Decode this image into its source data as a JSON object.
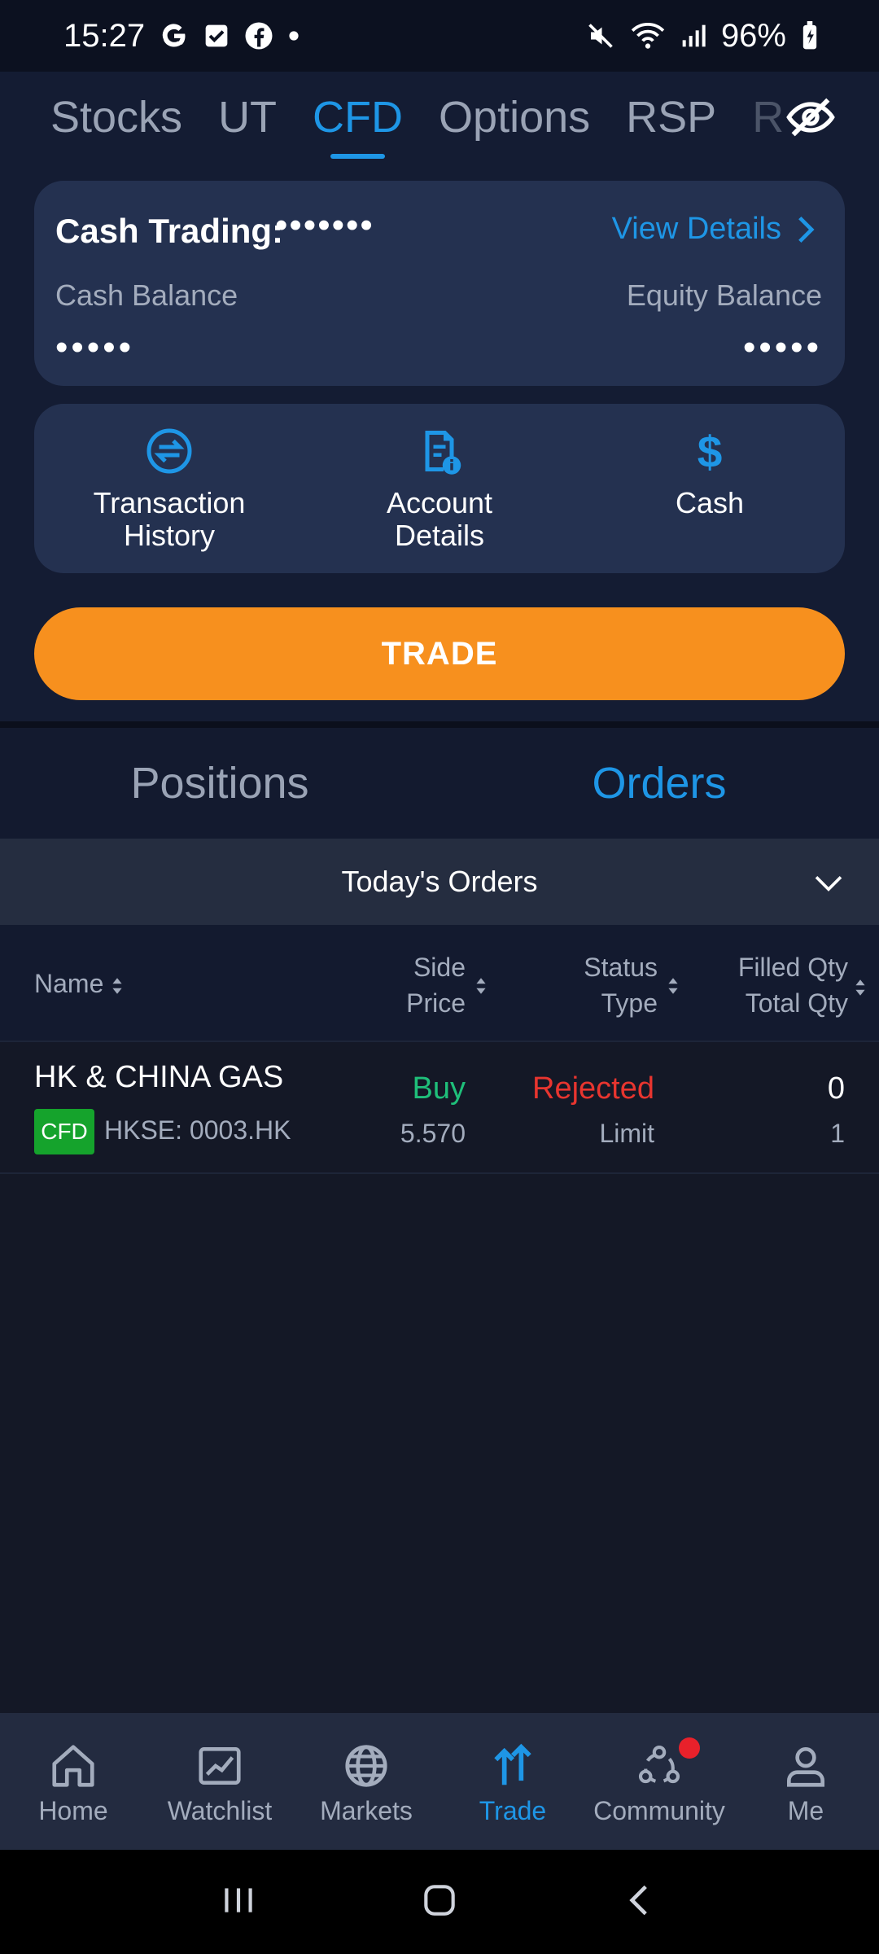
{
  "status_bar": {
    "time": "15:27",
    "battery": "96%",
    "icons": [
      "google-icon",
      "checkbox-icon",
      "facebook-icon",
      "dot-icon",
      "mute-icon",
      "wifi-icon",
      "signal-icon",
      "battery-icon"
    ]
  },
  "top_tabs": [
    {
      "label": "Stocks"
    },
    {
      "label": "UT"
    },
    {
      "label": "CFD"
    },
    {
      "label": "Options"
    },
    {
      "label": "RSP"
    },
    {
      "label": "R"
    }
  ],
  "cash_card": {
    "title": "Cash Trading:",
    "account_masked": "•••••••",
    "view_details": "View Details",
    "cash_balance_label": "Cash Balance",
    "cash_balance_value": "•••••",
    "equity_balance_label": "Equity Balance",
    "equity_balance_value": "•••••"
  },
  "actions": [
    {
      "label": "Transaction History"
    },
    {
      "label": "Account Details"
    },
    {
      "label": "Cash"
    }
  ],
  "trade_button": "TRADE",
  "list_tabs": {
    "positions": "Positions",
    "orders": "Orders"
  },
  "orders_filter": "Today's Orders",
  "table_headers": {
    "name": "Name",
    "side": "Side",
    "price": "Price",
    "status": "Status",
    "type": "Type",
    "filled_qty": "Filled Qty",
    "total_qty": "Total Qty"
  },
  "orders": [
    {
      "name": "HK & CHINA GAS",
      "badge": "CFD",
      "code": "HKSE: 0003.HK",
      "side": "Buy",
      "price": "5.570",
      "status": "Rejected",
      "type": "Limit",
      "filled_qty": "0",
      "total_qty": "1"
    }
  ],
  "bottom_nav": [
    {
      "label": "Home"
    },
    {
      "label": "Watchlist"
    },
    {
      "label": "Markets"
    },
    {
      "label": "Trade"
    },
    {
      "label": "Community"
    },
    {
      "label": "Me"
    }
  ],
  "colors": {
    "accent": "#1e96e6",
    "trade_button": "#f7901e",
    "buy": "#1fbf7a",
    "rejected": "#e8352f",
    "badge": "#15a32c"
  }
}
